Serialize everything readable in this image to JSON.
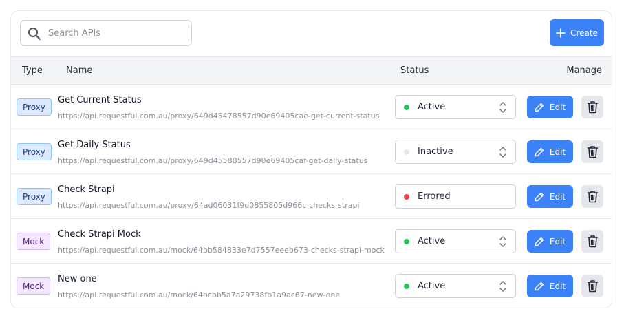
{
  "search": {
    "placeholder": "Search APIs",
    "value": ""
  },
  "toolbar": {
    "create_label": "Create"
  },
  "table": {
    "headers": {
      "type": "Type",
      "name": "Name",
      "status": "Status",
      "manage": "Manage"
    },
    "rows": [
      {
        "type": "Proxy",
        "name": "Get Current Status",
        "url": "https://api.requestful.com.au/proxy/649d45478557d90e69405cae-get-current-status",
        "status": "Active",
        "status_color": "#22c55e",
        "has_chevron": true,
        "edit_label": "Edit"
      },
      {
        "type": "Proxy",
        "name": "Get Daily Status",
        "url": "https://api.requestful.com.au/proxy/649d45588557d90e69405caf-get-daily-status",
        "status": "Inactive",
        "status_color": "#e5e7eb",
        "has_chevron": true,
        "edit_label": "Edit"
      },
      {
        "type": "Proxy",
        "name": "Check Strapi",
        "url": "https://api.requestful.com.au/proxy/64ad06031f9d0855805d966c-checks-strapi",
        "status": "Errored",
        "status_color": "#ef4444",
        "has_chevron": false,
        "edit_label": "Edit"
      },
      {
        "type": "Mock",
        "name": "Check Strapi Mock",
        "url": "https://api.requestful.com.au/mock/64bb584833e7d7557eeeb673-checks-strapi-mock",
        "status": "Active",
        "status_color": "#22c55e",
        "has_chevron": true,
        "edit_label": "Edit"
      },
      {
        "type": "Mock",
        "name": "New one",
        "url": "https://api.requestful.com.au/mock/64bcbb5a7a29738fb1a9ac67-new-one",
        "status": "Active",
        "status_color": "#22c55e",
        "has_chevron": true,
        "edit_label": "Edit"
      }
    ]
  },
  "colors": {
    "accent": "#3b82f6",
    "active": "#22c55e",
    "inactive": "#e5e7eb",
    "errored": "#ef4444"
  },
  "icons": {
    "search": "search-icon",
    "create": "plus-icon",
    "edit": "pencil-icon",
    "delete": "trash-icon",
    "select": "chevron-up-down-icon"
  }
}
